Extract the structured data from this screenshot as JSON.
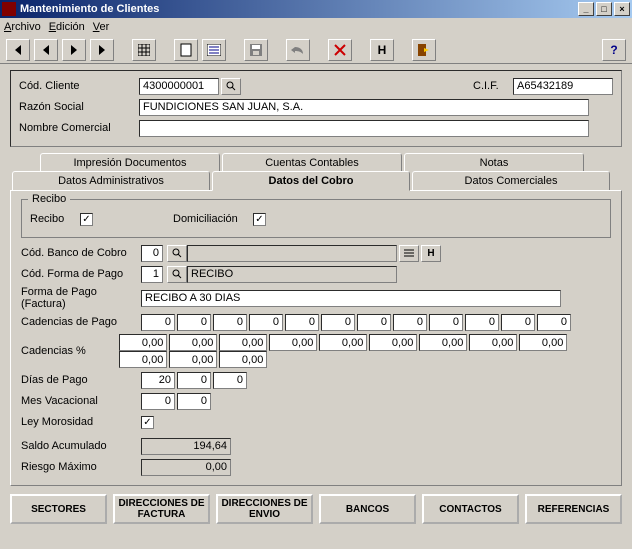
{
  "window": {
    "title": "Mantenimiento de Clientes"
  },
  "menu": {
    "archivo": "Archivo",
    "edicion": "Edición",
    "ver": "Ver"
  },
  "toolbar": {
    "h_label": "H"
  },
  "header": {
    "cod_cliente_lbl": "Cód. Cliente",
    "cod_cliente_val": "4300000001",
    "cif_lbl": "C.I.F.",
    "cif_val": "A65432189",
    "razon_lbl": "Razón Social",
    "razon_val": "FUNDICIONES SAN JUAN, S.A.",
    "nombre_lbl": "Nombre Comercial",
    "nombre_val": ""
  },
  "tabs": {
    "row1": [
      "Impresión Documentos",
      "Cuentas Contables",
      "Notas"
    ],
    "row2": [
      "Datos Administrativos",
      "Datos del Cobro",
      "Datos Comerciales"
    ]
  },
  "cobro": {
    "group_title": "Recibo",
    "recibo_lbl": "Recibo",
    "recibo_chk": "✓",
    "domic_lbl": "Domiciliación",
    "domic_chk": "✓",
    "banco_lbl": "Cód. Banco de Cobro",
    "banco_val": "0",
    "formapago_cod_lbl": "Cód. Forma de Pago",
    "formapago_cod_val": "1",
    "formapago_cod_desc": "RECIBO",
    "formapago_fact_lbl": "Forma de Pago (Factura)",
    "formapago_fact_val": "RECIBO A 30 DIAS",
    "cadencias_lbl": "Cadencias de Pago",
    "cadencias": [
      "0",
      "0",
      "0",
      "0",
      "0",
      "0",
      "0",
      "0",
      "0",
      "0",
      "0",
      "0"
    ],
    "cadencias_pct_lbl": "Cadencias %",
    "cadencias_pct": [
      "0,00",
      "0,00",
      "0,00",
      "0,00",
      "0,00",
      "0,00",
      "0,00",
      "0,00",
      "0,00",
      "0,00",
      "0,00",
      "0,00"
    ],
    "dias_lbl": "Días de Pago",
    "dias": [
      "20",
      "0",
      "0"
    ],
    "mes_lbl": "Mes Vacacional",
    "mes": [
      "0",
      "0"
    ],
    "ley_lbl": "Ley Morosidad",
    "ley_chk": "✓",
    "saldo_lbl": "Saldo Acumulado",
    "saldo_val": "194,64",
    "riesgo_lbl": "Riesgo Máximo",
    "riesgo_val": "0,00",
    "h_btn": "H"
  },
  "footer": {
    "sectores": "SECTORES",
    "dir_fact": "DIRECCIONES DE FACTURA",
    "dir_envio": "DIRECCIONES DE ENVIO",
    "bancos": "BANCOS",
    "contactos": "CONTACTOS",
    "referencias": "REFERENCIAS"
  }
}
